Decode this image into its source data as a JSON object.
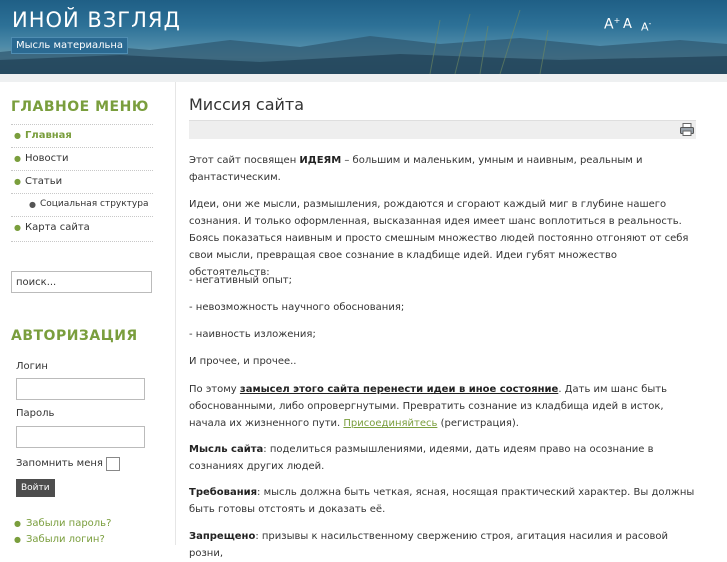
{
  "site": {
    "title": "ИНОЙ ВЗГЛЯД",
    "slogan": "Мысль материальна"
  },
  "font_sizer": {
    "plus": "A",
    "plus_sup": "+",
    "normal": "A",
    "minus": "A",
    "minus_sup": "-"
  },
  "sidebar": {
    "menu_title": "ГЛАВНОЕ МЕНЮ",
    "menu": [
      {
        "label": "Главная"
      },
      {
        "label": "Новости"
      },
      {
        "label": "Статьи"
      },
      {
        "label": "Социальная структура"
      },
      {
        "label": "Карта сайта"
      }
    ],
    "search_placeholder": "поиск...",
    "auth_title": "АВТОРИЗАЦИЯ",
    "login_label": "Логин",
    "password_label": "Пароль",
    "remember_label": "Запомнить меня",
    "submit_label": "Войти",
    "forgot_password": "Забыли пароль?",
    "forgot_login": "Забыли логин?"
  },
  "article": {
    "title": "Миссия сайта",
    "p1_before": "Этот сайт посвящен ",
    "p1_bold": "ИДЕЯМ",
    "p1_after": " – большим и маленьким, умным и наивным, реальным и фантастическим.",
    "p2": "Идеи, они же мысли, размышления, рождаются и сгорают каждый миг в глубине нашего сознания. И только оформленная, высказанная идея имеет шанс воплотиться в реальность. Боясь показаться наивным и просто смешным множество людей постоянно отгоняют от себя свои мысли, превращая свое сознание в кладбище идей. Идеи губят множество обстоятельств:",
    "li1": "- негативный опыт;",
    "li2": "- невозможность научного обоснования;",
    "li3": "- наивность изложения;",
    "p3": "И прочее, и прочее..",
    "p4_before": "По этому ",
    "p4_bold": "замысел этого сайта перенести идеи в иное состояние",
    "p4_mid": ". Дать им шанс быть обоснованными, либо опровергнутыми. Превратить сознание из кладбища идей в исток, начала их жизненного пути. ",
    "p4_link": "Присоединяйтесь",
    "p4_after": " (регистрация).",
    "p5_bold": "Мысль сайта",
    "p5_rest": ": поделиться размышлениями, идеями, дать идеям право на осознание в сознаниях других людей.",
    "p6_bold": "Требования",
    "p6_rest": ": мысль должна быть четкая, ясная, носящая практический характер. Вы должны быть готовы отстоять и доказать её.",
    "p7_bold": "Запрещено",
    "p7_rest": ": призывы к насильственному свержению строя, агитация насилия и расовой розни,"
  },
  "colors": {
    "accent": "#7a9e3d",
    "header": "#2d7197"
  },
  "icons": [
    "print-icon"
  ]
}
